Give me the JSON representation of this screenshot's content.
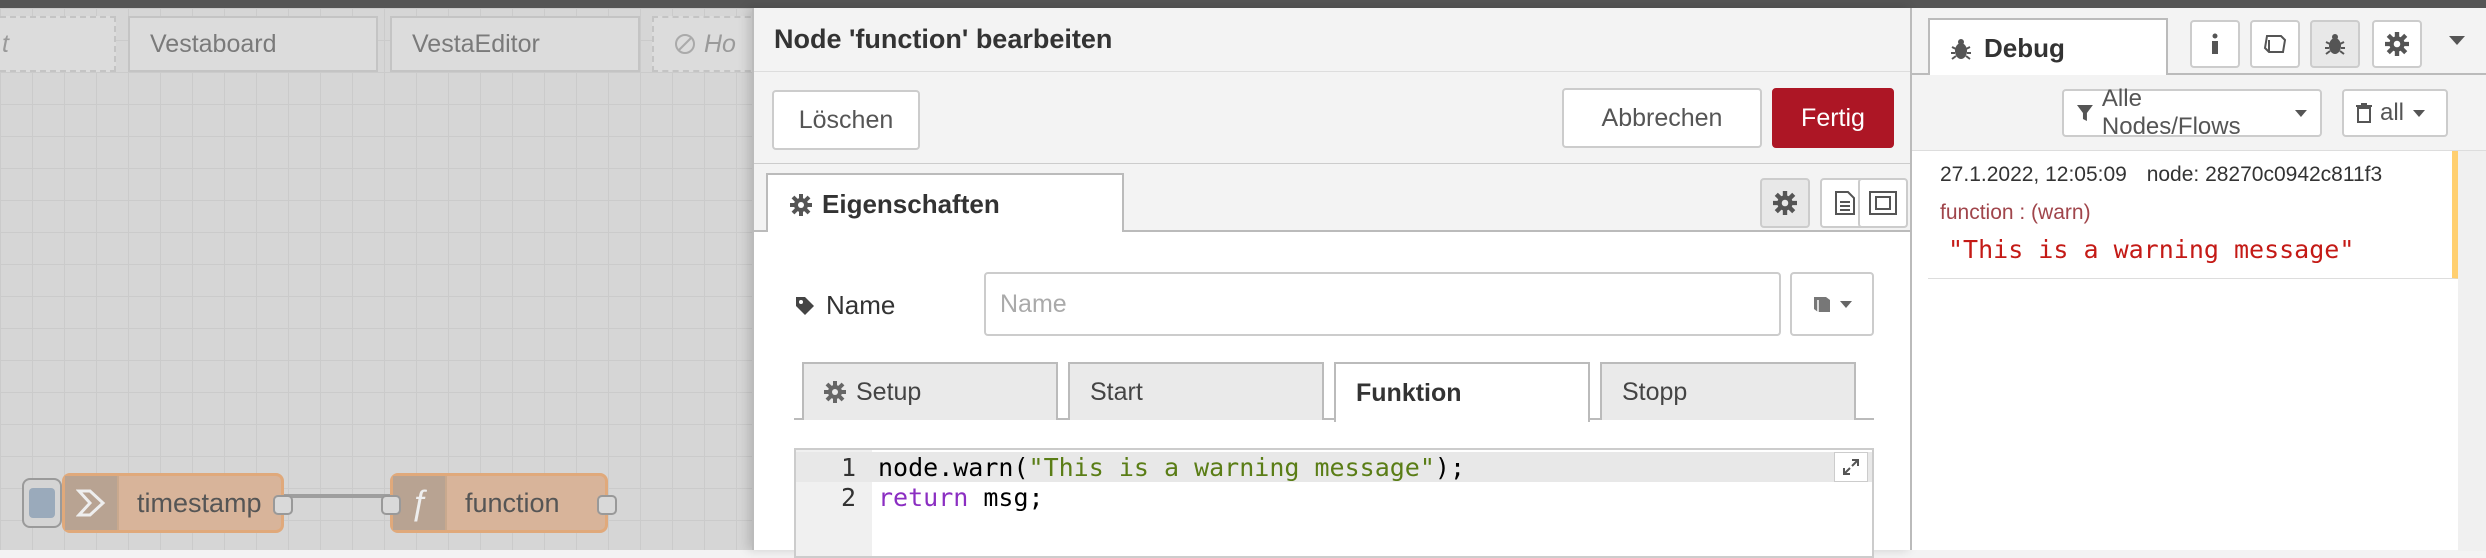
{
  "workspace": {
    "tabs": [
      {
        "label": "t",
        "style": "dashed"
      },
      {
        "label": "Vestaboard"
      },
      {
        "label": "VestaEditor"
      },
      {
        "label": "Ho",
        "style": "dashed-disabled"
      }
    ],
    "nodes": {
      "timestamp": {
        "label": "timestamp",
        "icon": "arrow-right-icon"
      },
      "function": {
        "label": "function",
        "icon": "function-f-icon"
      }
    }
  },
  "tray": {
    "title": "Node 'function' bearbeiten",
    "toolbar": {
      "delete_label": "Löschen",
      "cancel_label": "Abbrechen",
      "done_label": "Fertig"
    },
    "tabs": {
      "properties_label": "Eigenschaften"
    },
    "name_field": {
      "label": "Name",
      "placeholder": "Name",
      "value": ""
    },
    "func_tabs": [
      {
        "label": "Setup",
        "icon": "gear-icon"
      },
      {
        "label": "Start"
      },
      {
        "label": "Funktion",
        "active": true
      },
      {
        "label": "Stopp"
      }
    ],
    "code": {
      "line_numbers": [
        "1",
        "2"
      ],
      "line1": {
        "pre": "node.warn(",
        "str": "\"This is a warning message\"",
        "post": ");"
      },
      "line2": {
        "kw": "return",
        "rest": " msg;"
      }
    }
  },
  "sidebar": {
    "active_tab": "Debug",
    "filter_label": "Alle Nodes/Flows",
    "clear_label": "all",
    "message": {
      "timestamp": "27.1.2022, 12:05:09",
      "node": "node: 28270c0942c811f3",
      "topic": "function : (warn)",
      "body": "\"This is a warning message\""
    }
  },
  "colors": {
    "primary_button": "#ad1625",
    "node_border": "#e0a97b",
    "warn_bar": "#ffcf70",
    "string_token": "#5a7d16",
    "keyword_token": "#8b2ec2"
  }
}
